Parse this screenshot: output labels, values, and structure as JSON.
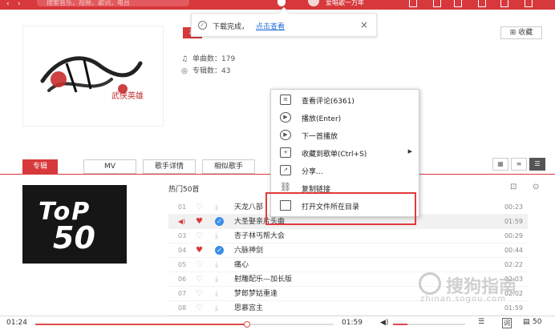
{
  "topbar": {
    "search_placeholder": "搜索音乐，视频，歌词，电台",
    "user_name": "爱唱歌一万年"
  },
  "toast": {
    "message": "下载完成，",
    "link": "点击查看"
  },
  "artist": {
    "tag": "歌",
    "cover_text": "武侠英雄",
    "songs_label": "单曲数：",
    "songs_count": "179",
    "albums_label": "专辑数：",
    "albums_count": "43",
    "fav_label": "收藏"
  },
  "tabs": [
    {
      "label": "专辑"
    },
    {
      "label": "MV"
    },
    {
      "label": "歌手详情"
    },
    {
      "label": "相似歌手"
    }
  ],
  "album_tile": {
    "line1": "ToP",
    "line2": "50"
  },
  "song_list": {
    "title": "热门50首",
    "rows": [
      {
        "num": "01",
        "name": "天龙八部",
        "time": "00:23",
        "liked": false,
        "downloaded": false
      },
      {
        "num": "02",
        "name": "大圣娶亲片头曲",
        "time": "01:59",
        "liked": true,
        "downloaded": true
      },
      {
        "num": "03",
        "name": "杏子林丐帮大会",
        "time": "00:29",
        "liked": false,
        "downloaded": false
      },
      {
        "num": "04",
        "name": "六脉神剑",
        "time": "00:44",
        "liked": true,
        "downloaded": true
      },
      {
        "num": "05",
        "name": "痛心",
        "time": "02:22",
        "liked": false,
        "downloaded": false
      },
      {
        "num": "06",
        "name": "射雕配乐—加长版",
        "time": "02:03",
        "liked": false,
        "downloaded": false
      },
      {
        "num": "07",
        "name": "梦郎梦姑重逢",
        "time": "02:02",
        "liked": false,
        "downloaded": false
      },
      {
        "num": "08",
        "name": "思慕宫主",
        "time": "01:59",
        "liked": false,
        "downloaded": false
      }
    ]
  },
  "context_menu": {
    "items": [
      {
        "icon": "comment-icon",
        "label": "查看评论(6361)"
      },
      {
        "icon": "play-icon",
        "label": "播放(Enter)"
      },
      {
        "icon": "play-next-icon",
        "label": "下一首播放"
      },
      {
        "icon": "add-to-playlist-icon",
        "label": "收藏到歌单(Ctrl+S)",
        "submenu": true
      },
      {
        "icon": "share-icon",
        "label": "分享..."
      },
      {
        "icon": "link-icon",
        "label": "复制链接"
      },
      {
        "icon": "folder-icon",
        "label": "打开文件所在目录"
      }
    ]
  },
  "watermark": {
    "text": "搜狗指南",
    "url": "zhinan.sogou.com"
  },
  "player": {
    "current_time": "01:24",
    "total_time": "01:59",
    "progress": 0.71,
    "volume": 0.2,
    "lyric_label": "词",
    "playlist_count": "50"
  },
  "colors": {
    "accent": "#d7383c",
    "highlight_box": "#e03a3a"
  }
}
